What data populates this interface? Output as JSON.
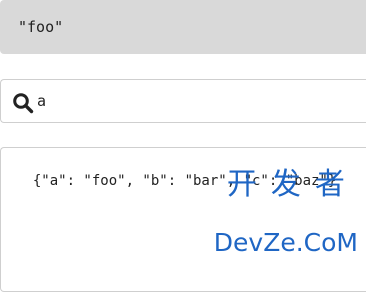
{
  "result": {
    "value": "\"foo\""
  },
  "search": {
    "value": "a",
    "icon": "search-icon"
  },
  "json_input": {
    "value": "{\"a\": \"foo\", \"b\": \"bar\", \"c\": \"baz\"}"
  },
  "watermark": {
    "line1": "开发者",
    "line2": "DevZe.CoM"
  },
  "colors": {
    "result_bg": "#d9d9d9",
    "border": "#cfcfcf",
    "watermark": "#1f66c4"
  }
}
